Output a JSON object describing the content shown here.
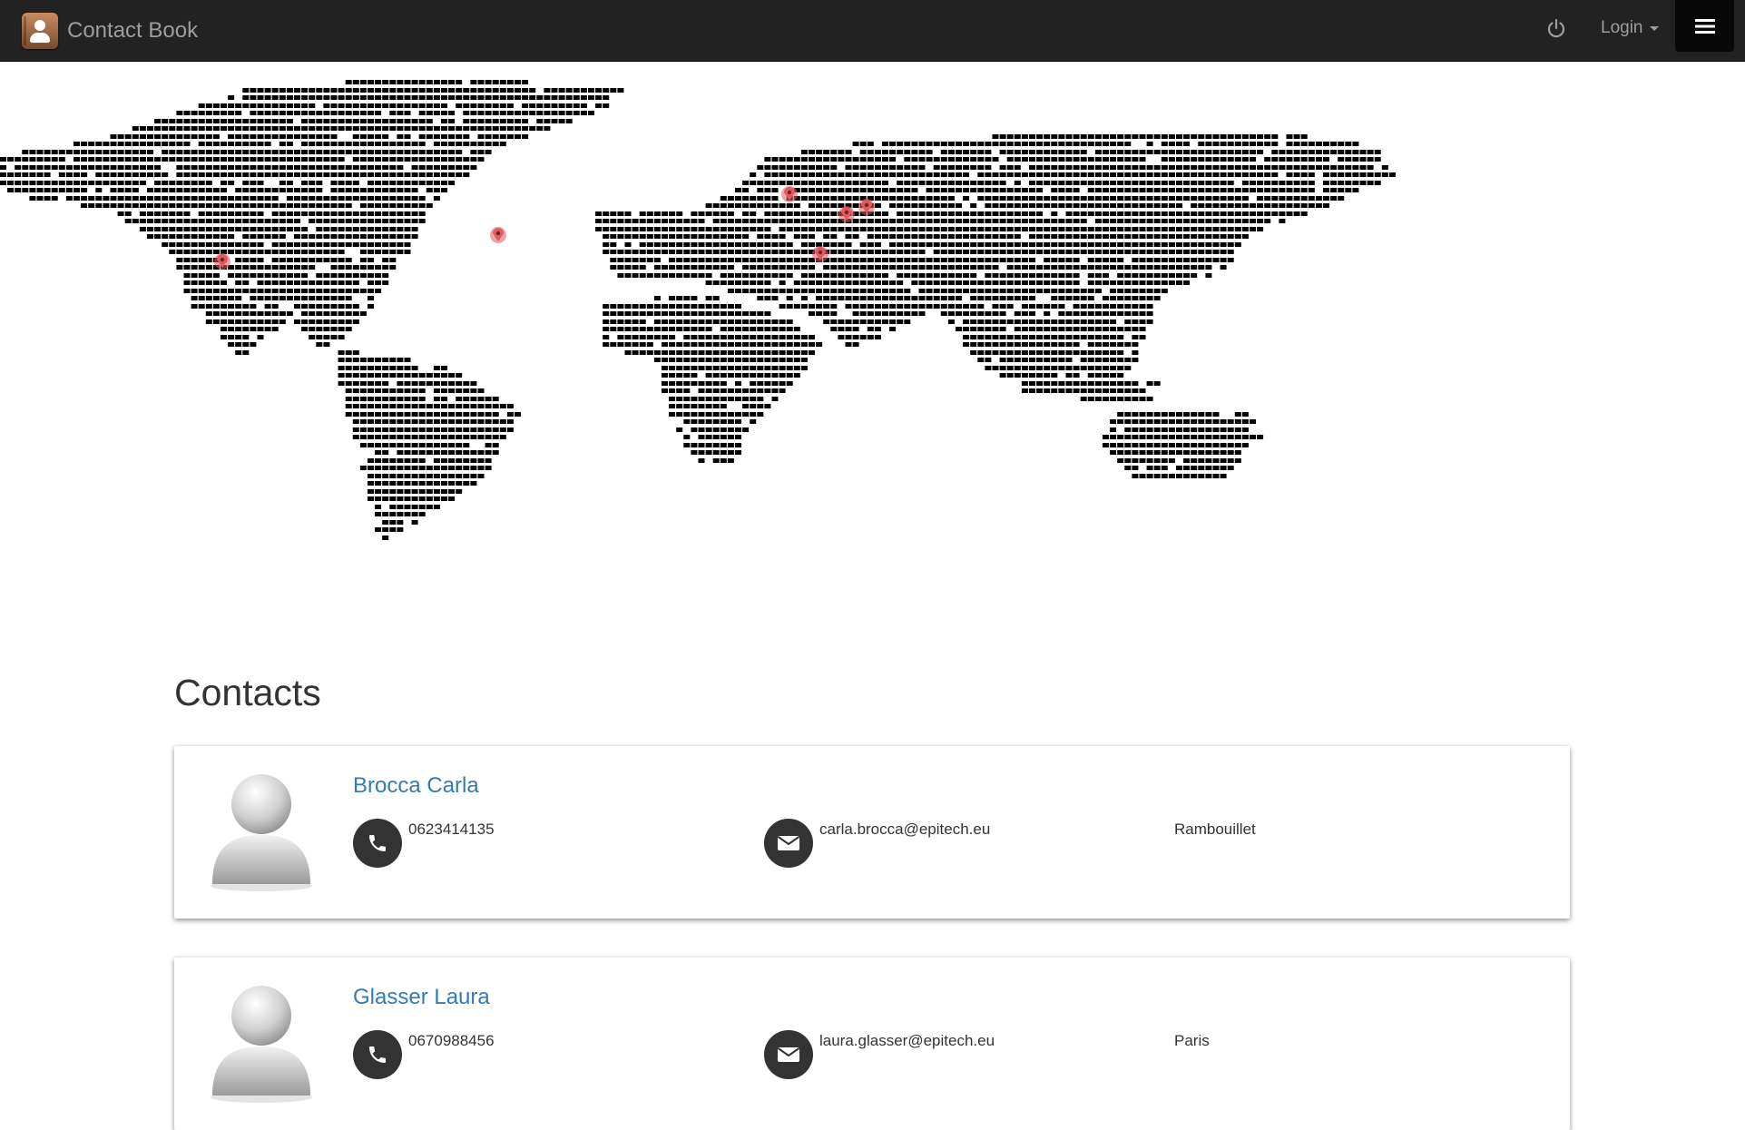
{
  "app": {
    "brand": "Contact Book"
  },
  "header": {
    "login_label": "Login"
  },
  "icons": {
    "brand": "contact-book-icon",
    "power": "power-icon",
    "menu": "hamburger-icon",
    "phone": "phone-icon",
    "email": "envelope-icon",
    "avatar": "user-avatar-icon",
    "marker": "map-marker-icon"
  },
  "colors": {
    "navbar": "#222222",
    "navbar_text": "#9d9d9d",
    "link": "#337ab7",
    "map_dot": "#000000",
    "marker": "#e05a5f"
  },
  "main": {
    "title": "Contacts"
  },
  "contacts": [
    {
      "name": "Brocca Carla",
      "phone": "0623414135",
      "email": "carla.brocca@epitech.eu",
      "city": "Rambouillet"
    },
    {
      "name": "Glasser Laura",
      "phone": "0670988456",
      "email": "laura.glasser@epitech.eu",
      "city": "Paris"
    }
  ]
}
